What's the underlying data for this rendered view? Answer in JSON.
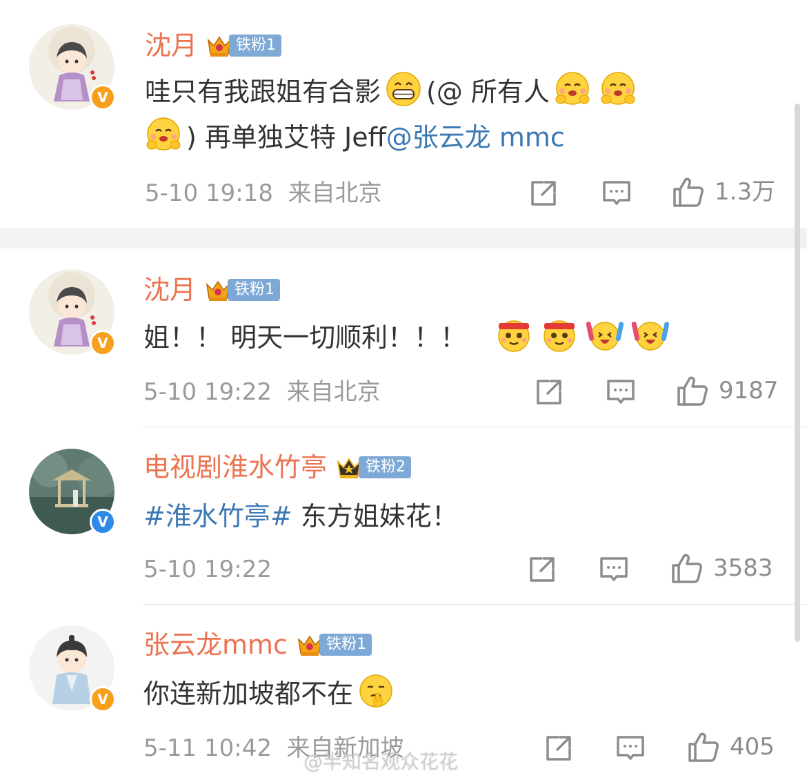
{
  "comments": [
    {
      "username": "沈月",
      "fan_badge": "铁粉1",
      "verified": "gold",
      "text_line1_a": "哇只有我跟姐有合影",
      "text_line1_b": "(@ 所有人",
      "text_line2_a": ") 再单独艾特 Jeff",
      "text_line2_mention": "@张云龙 mmc",
      "time": "5-10 19:18",
      "location": "来自北京",
      "likes": "1.3万"
    },
    {
      "username": "沈月",
      "fan_badge": "铁粉1",
      "verified": "gold",
      "text": "姐！！ 明天一切顺利！！！",
      "time": "5-10 19:22",
      "location": "来自北京",
      "likes": "9187"
    },
    {
      "username": "电视剧淮水竹亭",
      "fan_badge": "铁粉2",
      "verified": "blue",
      "text_tag": "#淮水竹亭#",
      "text_rest": "东方姐妹花！",
      "time": "5-10 19:22",
      "location": "",
      "likes": "3583"
    },
    {
      "username": "张云龙mmc",
      "fan_badge": "铁粉1",
      "verified": "gold",
      "text": "你连新加坡都不在",
      "time": "5-11 10:42",
      "location": "来自新加坡",
      "likes": "405"
    }
  ],
  "icons": {
    "repost": "repost-icon",
    "comment": "comment-icon",
    "like": "thumbs-up-icon",
    "verified": "verified-v-icon",
    "crown": "crown-icon"
  },
  "colors": {
    "username": "#eb7350",
    "link": "#3c78b4",
    "meta": "#9a9a9a",
    "fan_badge": "#7ea9d6",
    "verified_gold": "#f7a01e",
    "verified_blue": "#2e8ae6"
  },
  "watermark": "@半知名观众花花"
}
